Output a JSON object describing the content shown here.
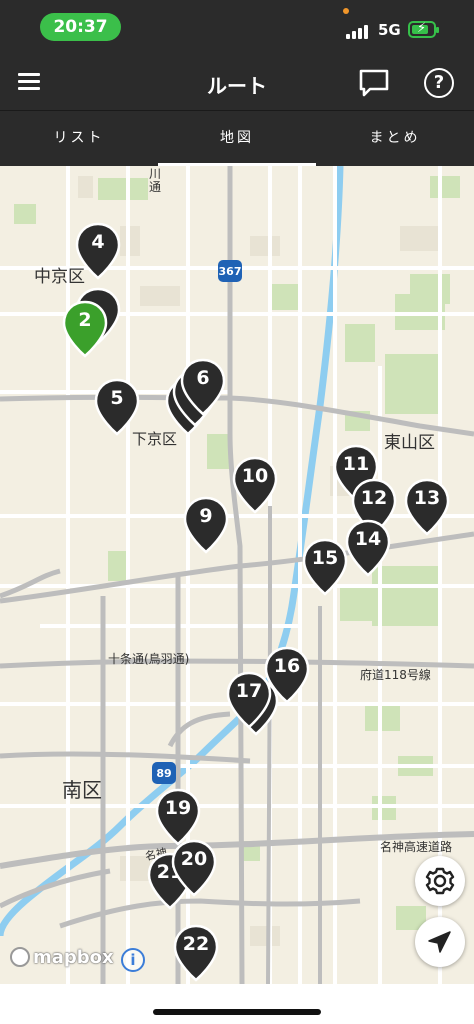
{
  "status_bar": {
    "time": "20:37",
    "network": "5G",
    "battery_charging": true
  },
  "header": {
    "title": "ルート",
    "menu_icon": "menu-icon",
    "chat_icon": "chat-bubble-icon",
    "help_icon": "help-icon",
    "help_glyph": "?"
  },
  "tabs": [
    {
      "label": "リスト",
      "active": false
    },
    {
      "label": "地図",
      "active": true
    },
    {
      "label": "まとめ",
      "active": false
    }
  ],
  "map": {
    "labels": {
      "kawa": "川通",
      "nakagyo": "中京区",
      "shimogyo": "下京区",
      "higashiyama": "東山区",
      "jujo": "十条通(鳥羽通)",
      "fudo118": "府道118号線",
      "minami": "南区",
      "meishin_left": "名神",
      "meishin_right": "名神高速道路",
      "route367": "367",
      "route89": "89"
    },
    "pins": [
      {
        "label": "4",
        "color": "#2b2b2b"
      },
      {
        "label": "",
        "color": "#2b2b2b"
      },
      {
        "label": "2",
        "color": "#3ba02b"
      },
      {
        "label": "5",
        "color": "#2b2b2b"
      },
      {
        "label": "",
        "color": "#2b2b2b"
      },
      {
        "label": "",
        "color": "#2b2b2b"
      },
      {
        "label": "6",
        "color": "#2b2b2b"
      },
      {
        "label": "10",
        "color": "#2b2b2b"
      },
      {
        "label": "9",
        "color": "#2b2b2b"
      },
      {
        "label": "11",
        "color": "#2b2b2b"
      },
      {
        "label": "12",
        "color": "#2b2b2b"
      },
      {
        "label": "13",
        "color": "#2b2b2b"
      },
      {
        "label": "14",
        "color": "#2b2b2b"
      },
      {
        "label": "15",
        "color": "#2b2b2b"
      },
      {
        "label": "16",
        "color": "#2b2b2b"
      },
      {
        "label": "",
        "color": "#2b2b2b"
      },
      {
        "label": "17",
        "color": "#2b2b2b"
      },
      {
        "label": "19",
        "color": "#2b2b2b"
      },
      {
        "label": "21",
        "color": "#2b2b2b"
      },
      {
        "label": "20",
        "color": "#2b2b2b"
      },
      {
        "label": "22",
        "color": "#2b2b2b"
      }
    ],
    "attribution": "mapbox",
    "info_glyph": "i",
    "settings_icon": "gear-icon",
    "locate_icon": "location-arrow-icon"
  }
}
